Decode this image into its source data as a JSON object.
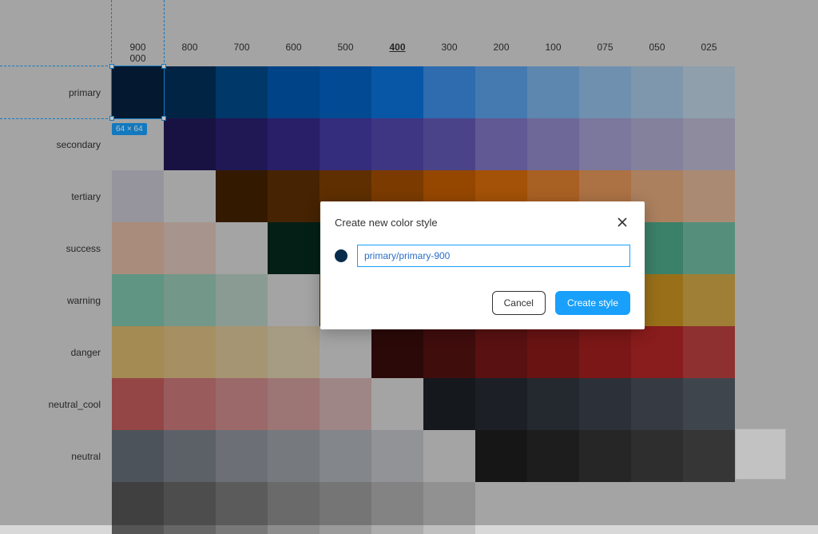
{
  "selection": {
    "dim_badge": "64 × 64",
    "selected_color": "#082c4b"
  },
  "column_headers": [
    "900",
    "800",
    "700",
    "600",
    "500",
    "400",
    "300",
    "200",
    "100",
    "075",
    "050",
    "025",
    "000"
  ],
  "strong_column_index": 5,
  "rows": [
    {
      "name": "primary",
      "colors": [
        "#06223f",
        "#03305a",
        "#014a8c",
        "#0059b0",
        "#0362c3",
        "#0b73dc",
        "#3d8fe6",
        "#5ba1e9",
        "#7cb2e8",
        "#93bee6",
        "#a6c7e4",
        "#bcd2e1",
        "#d8d8d8"
      ]
    },
    {
      "name": "secondary",
      "colors": [
        "#201858",
        "#2a2070",
        "#362a8a",
        "#453ba3",
        "#5247ab",
        "#6358b5",
        "#7f76c3",
        "#9089c8",
        "#a29dcf",
        "#aeaacf",
        "#bab7cf",
        "#c5c4cf",
        "#d8d8d8"
      ]
    },
    {
      "name": "tertiary",
      "colors": [
        "#442101",
        "#5c2e03",
        "#7e3e03",
        "#a24e00",
        "#c45e00",
        "#d86c0a",
        "#de7f2e",
        "#e2965a",
        "#e1a97e",
        "#e0b697",
        "#deb9a4",
        "#dcc3b8",
        "#d8d8d8"
      ]
    },
    {
      "name": "success",
      "colors": [
        "#062b1e",
        "#053a29",
        "#054733",
        "#035c40",
        "#036e4d",
        "#0c8059",
        "#2e9673",
        "#4ea98b",
        "#70bca3",
        "#7fc3ac",
        "#97c7b4",
        "#b6ccc1",
        "#d8d8d8"
      ]
    },
    {
      "name": "warning",
      "colors": [
        "#4a3700",
        "#624600",
        "#7a5500",
        "#986900",
        "#b27b00",
        "#c28900",
        "#c99422",
        "#d2a748",
        "#d8b66e",
        "#dabd82",
        "#dbc497",
        "#dbccad",
        "#d8d8d8"
      ]
    },
    {
      "name": "danger",
      "colors": [
        "#3b0d0d",
        "#551212",
        "#761717",
        "#8b1a1a",
        "#a31f1f",
        "#b42626",
        "#bd4040",
        "#c35d5d",
        "#c97878",
        "#cc8a8a",
        "#ce9a9a",
        "#d1b0b0",
        "#d8d8d8"
      ]
    },
    {
      "name": "neutral_cool",
      "colors": [
        "#1c2026",
        "#262b33",
        "#30363f",
        "#3a414b",
        "#474e59",
        "#545b65",
        "#666d77",
        "#7a8089",
        "#8e939b",
        "#9ca0a6",
        "#adb1b6",
        "#c0c2c5",
        "#d8d8d8"
      ]
    },
    {
      "name": "neutral",
      "colors": [
        "#1d1d1d",
        "#272727",
        "#323232",
        "#3d3d3d",
        "#484848",
        "#555555",
        "#666666",
        "#787878",
        "#8c8c8c",
        "#9a9a9a",
        "#acacac",
        "#bfbfbf",
        "#d8d8d8"
      ]
    }
  ],
  "modal": {
    "title": "Create new color style",
    "input_value": "primary/primary-900",
    "cancel_label": "Cancel",
    "create_label": "Create style"
  }
}
